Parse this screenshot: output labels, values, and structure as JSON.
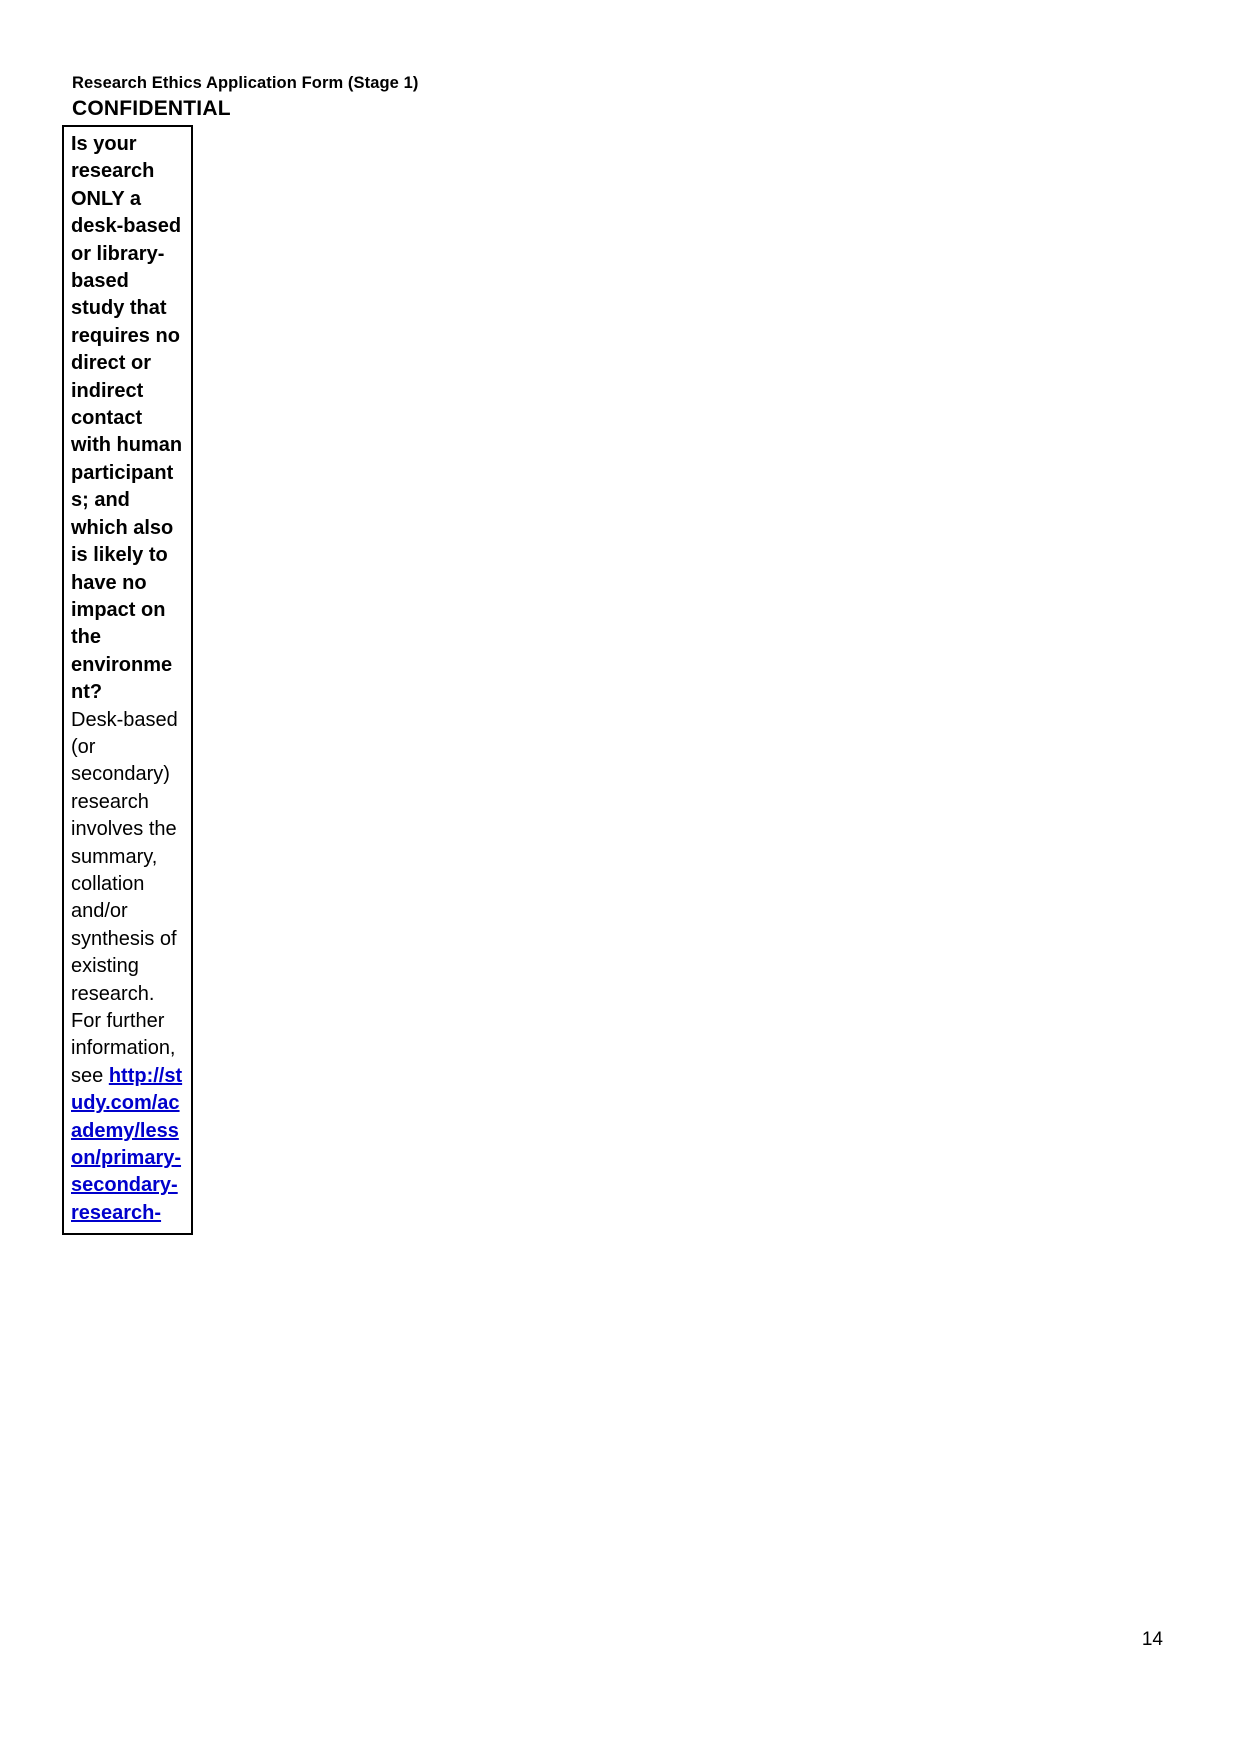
{
  "header": {
    "form_title": "Research Ethics Application Form (Stage 1)",
    "confidential_label": "CONFIDENTIAL"
  },
  "table": {
    "question_text": "Is your research ONLY a desk-based or library-based study that requires no direct or indirect contact with human participants; and which also is likely to have no impact on the environment?",
    "body_text": "Desk-based (or secondary) research involves the summary, collation and/or synthesis of existing research. For further information, see ",
    "link_text": "http://study.com/academy/lesson/primary-secondary-research-"
  },
  "footer": {
    "page_number": "14"
  },
  "colors": {
    "link": "#0000cc",
    "text": "#000000",
    "border": "#000000",
    "background": "#ffffff"
  }
}
